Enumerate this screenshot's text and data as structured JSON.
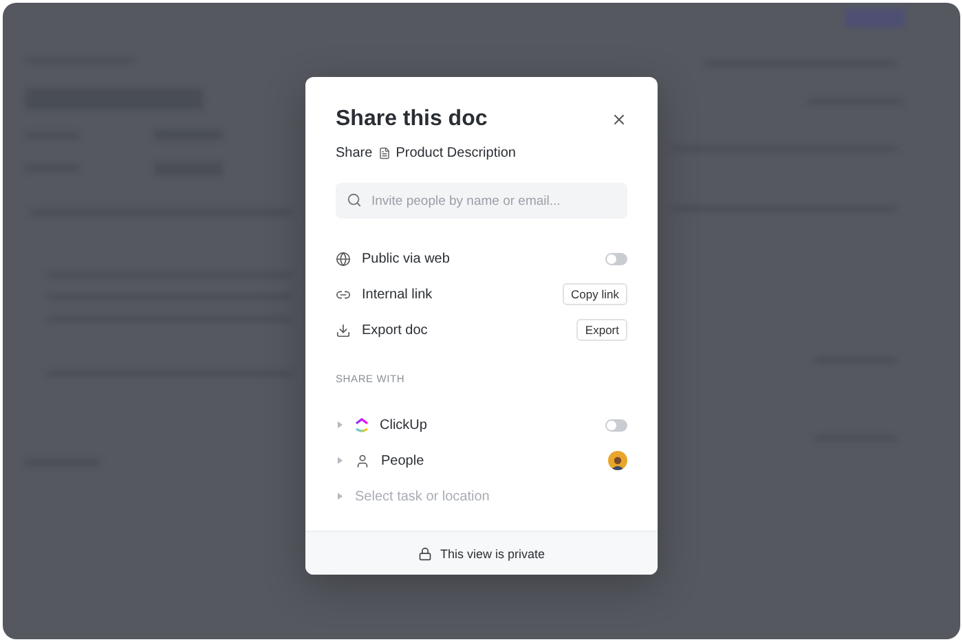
{
  "dialog": {
    "title": "Share this doc",
    "breadcrumb": {
      "prefix": "Share",
      "doc": "Product Description"
    },
    "search": {
      "placeholder": "Invite people by name or email..."
    },
    "options": [
      {
        "kind": "toggle",
        "label": "Public via web",
        "on": false
      },
      {
        "kind": "button",
        "label": "Internal link",
        "action": "Copy link"
      },
      {
        "kind": "button",
        "label": "Export doc",
        "action": "Export"
      }
    ],
    "share_with": {
      "heading": "SHARE WITH",
      "items": [
        {
          "kind": "toggle",
          "label": "ClickUp",
          "on": false,
          "expanded": false
        },
        {
          "kind": "avatar",
          "label": "People",
          "expanded": false
        },
        {
          "kind": "placeholder",
          "label": "Select task or location",
          "expanded": false
        }
      ]
    },
    "footer": "This view is private"
  }
}
